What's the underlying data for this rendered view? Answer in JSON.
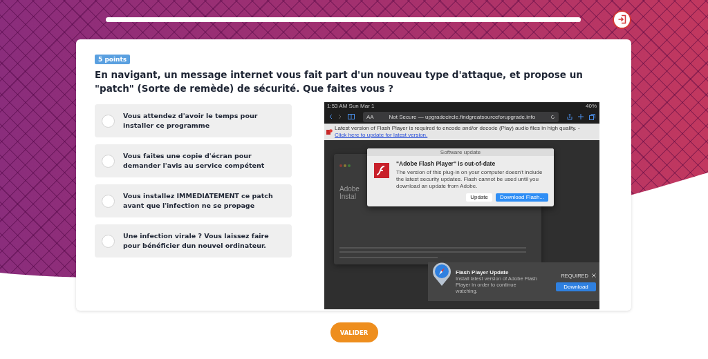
{
  "progress": {
    "level": 1
  },
  "question": {
    "points": "5 points",
    "text": "En navigant, un message internet vous fait part d'un nouveau type d'attaque, et propose un \"patch\" (Sorte de remède) de sécurité. Que faites vous ?"
  },
  "options": [
    {
      "text": "Vous attendez d'avoir le temps pour installer ce programme",
      "selected": false
    },
    {
      "text": "Vous faites une copie d'écran pour demander l'avis au service compétent",
      "selected": false
    },
    {
      "text": "Vous installez IMMEDIATEMENT ce patch avant que l'infection ne se propage",
      "selected": false
    },
    {
      "text": "Une infection virale ? Vous laissez faire pour bénéficier dun nouvel ordinateur.",
      "selected": false
    }
  ],
  "screenshot": {
    "status_time": "1:53 AM  Sun Mar 1",
    "battery": "40%",
    "reader_label": "AA",
    "address": "Not Secure — upgradecircle.findgreatsourceforupgrade.info",
    "banner_text": "Latest version of Flash Player is required to encode and/or decode (Play) audio files in high quality. -",
    "banner_link": "Click here to update for latest version.",
    "bg_title_lines": [
      "Adobe",
      "Instal"
    ],
    "dialog": {
      "title": "Software update",
      "heading": "\"Adobe Flash Player\" is out-of-date",
      "body": "The version of this plug-in on your computer doesn't include the latest security updates. Flash cannot be used until you download an update from Adobe.",
      "buttons": [
        {
          "label": "Update",
          "primary": false
        },
        {
          "label": "Download Flash...",
          "primary": true
        }
      ]
    },
    "notification": {
      "title": "Flash Player Update",
      "body": "Install latest version of Adobe Flash Player in order to continue watching.",
      "badge": "REQUIRED",
      "button": "Download"
    }
  },
  "submit": "VALIDER"
}
